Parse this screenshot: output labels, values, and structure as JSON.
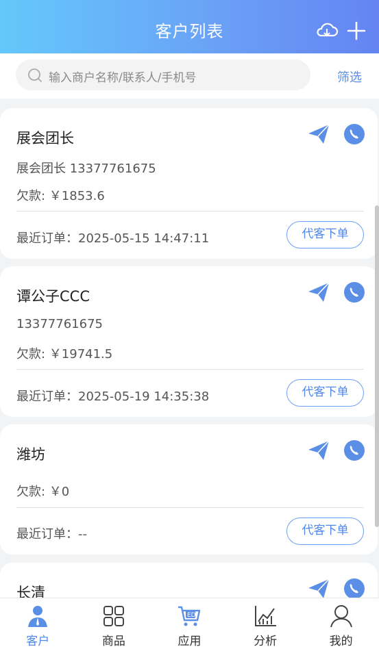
{
  "header": {
    "title": "客户列表"
  },
  "search": {
    "placeholder": "输入商户名称/联系人/手机号",
    "filter_label": "筛选"
  },
  "colors": {
    "accent": "#5b8fe6",
    "header_start": "#64c8fb",
    "header_end": "#6484f2"
  },
  "customers": [
    {
      "name": "展会团长",
      "contact": "展会团长 13377761675",
      "debt": "欠款: ￥1853.6",
      "recent": "最近订单：2025-05-15 14:47:11",
      "order_label": "代客下单"
    },
    {
      "name": "谭公子CCC",
      "contact": "13377761675",
      "debt": "欠款: ￥19741.5",
      "recent": "最近订单：2025-05-19 14:35:38",
      "order_label": "代客下单"
    },
    {
      "name": "潍坊",
      "contact": "",
      "debt": "欠款: ￥0",
      "recent": "最近订单：--",
      "order_label": "代客下单"
    },
    {
      "name": "长清"
    }
  ],
  "tabs": [
    {
      "label": "客户",
      "icon": "user-icon",
      "active": true
    },
    {
      "label": "商品",
      "icon": "grid-icon"
    },
    {
      "label": "应用",
      "icon": "cart-icon"
    },
    {
      "label": "分析",
      "icon": "chart-icon"
    },
    {
      "label": "我的",
      "icon": "profile-icon"
    }
  ]
}
